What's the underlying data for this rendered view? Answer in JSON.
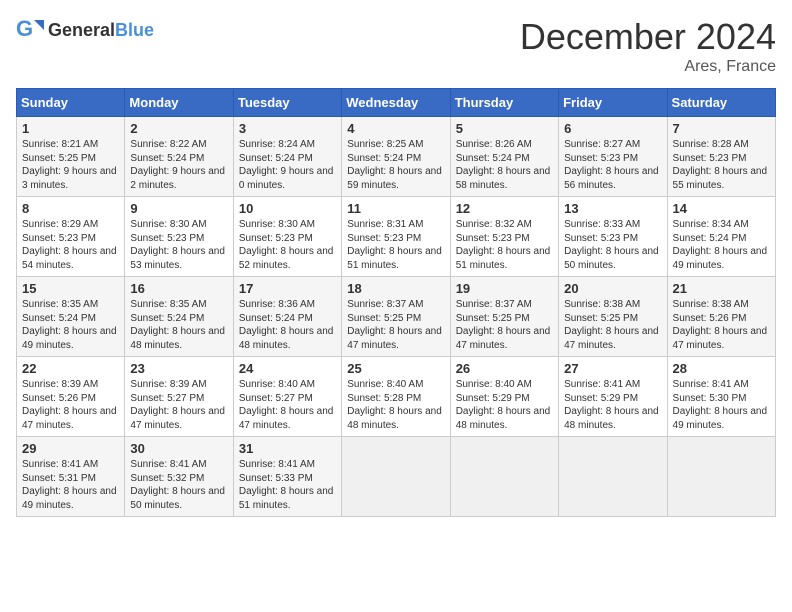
{
  "header": {
    "logo_general": "General",
    "logo_blue": "Blue",
    "title": "December 2024",
    "location": "Ares, France"
  },
  "days_of_week": [
    "Sunday",
    "Monday",
    "Tuesday",
    "Wednesday",
    "Thursday",
    "Friday",
    "Saturday"
  ],
  "weeks": [
    [
      {
        "day": "1",
        "sunrise": "Sunrise: 8:21 AM",
        "sunset": "Sunset: 5:25 PM",
        "daylight": "Daylight: 9 hours and 3 minutes."
      },
      {
        "day": "2",
        "sunrise": "Sunrise: 8:22 AM",
        "sunset": "Sunset: 5:24 PM",
        "daylight": "Daylight: 9 hours and 2 minutes."
      },
      {
        "day": "3",
        "sunrise": "Sunrise: 8:24 AM",
        "sunset": "Sunset: 5:24 PM",
        "daylight": "Daylight: 9 hours and 0 minutes."
      },
      {
        "day": "4",
        "sunrise": "Sunrise: 8:25 AM",
        "sunset": "Sunset: 5:24 PM",
        "daylight": "Daylight: 8 hours and 59 minutes."
      },
      {
        "day": "5",
        "sunrise": "Sunrise: 8:26 AM",
        "sunset": "Sunset: 5:24 PM",
        "daylight": "Daylight: 8 hours and 58 minutes."
      },
      {
        "day": "6",
        "sunrise": "Sunrise: 8:27 AM",
        "sunset": "Sunset: 5:23 PM",
        "daylight": "Daylight: 8 hours and 56 minutes."
      },
      {
        "day": "7",
        "sunrise": "Sunrise: 8:28 AM",
        "sunset": "Sunset: 5:23 PM",
        "daylight": "Daylight: 8 hours and 55 minutes."
      }
    ],
    [
      {
        "day": "8",
        "sunrise": "Sunrise: 8:29 AM",
        "sunset": "Sunset: 5:23 PM",
        "daylight": "Daylight: 8 hours and 54 minutes."
      },
      {
        "day": "9",
        "sunrise": "Sunrise: 8:30 AM",
        "sunset": "Sunset: 5:23 PM",
        "daylight": "Daylight: 8 hours and 53 minutes."
      },
      {
        "day": "10",
        "sunrise": "Sunrise: 8:30 AM",
        "sunset": "Sunset: 5:23 PM",
        "daylight": "Daylight: 8 hours and 52 minutes."
      },
      {
        "day": "11",
        "sunrise": "Sunrise: 8:31 AM",
        "sunset": "Sunset: 5:23 PM",
        "daylight": "Daylight: 8 hours and 51 minutes."
      },
      {
        "day": "12",
        "sunrise": "Sunrise: 8:32 AM",
        "sunset": "Sunset: 5:23 PM",
        "daylight": "Daylight: 8 hours and 51 minutes."
      },
      {
        "day": "13",
        "sunrise": "Sunrise: 8:33 AM",
        "sunset": "Sunset: 5:23 PM",
        "daylight": "Daylight: 8 hours and 50 minutes."
      },
      {
        "day": "14",
        "sunrise": "Sunrise: 8:34 AM",
        "sunset": "Sunset: 5:24 PM",
        "daylight": "Daylight: 8 hours and 49 minutes."
      }
    ],
    [
      {
        "day": "15",
        "sunrise": "Sunrise: 8:35 AM",
        "sunset": "Sunset: 5:24 PM",
        "daylight": "Daylight: 8 hours and 49 minutes."
      },
      {
        "day": "16",
        "sunrise": "Sunrise: 8:35 AM",
        "sunset": "Sunset: 5:24 PM",
        "daylight": "Daylight: 8 hours and 48 minutes."
      },
      {
        "day": "17",
        "sunrise": "Sunrise: 8:36 AM",
        "sunset": "Sunset: 5:24 PM",
        "daylight": "Daylight: 8 hours and 48 minutes."
      },
      {
        "day": "18",
        "sunrise": "Sunrise: 8:37 AM",
        "sunset": "Sunset: 5:25 PM",
        "daylight": "Daylight: 8 hours and 47 minutes."
      },
      {
        "day": "19",
        "sunrise": "Sunrise: 8:37 AM",
        "sunset": "Sunset: 5:25 PM",
        "daylight": "Daylight: 8 hours and 47 minutes."
      },
      {
        "day": "20",
        "sunrise": "Sunrise: 8:38 AM",
        "sunset": "Sunset: 5:25 PM",
        "daylight": "Daylight: 8 hours and 47 minutes."
      },
      {
        "day": "21",
        "sunrise": "Sunrise: 8:38 AM",
        "sunset": "Sunset: 5:26 PM",
        "daylight": "Daylight: 8 hours and 47 minutes."
      }
    ],
    [
      {
        "day": "22",
        "sunrise": "Sunrise: 8:39 AM",
        "sunset": "Sunset: 5:26 PM",
        "daylight": "Daylight: 8 hours and 47 minutes."
      },
      {
        "day": "23",
        "sunrise": "Sunrise: 8:39 AM",
        "sunset": "Sunset: 5:27 PM",
        "daylight": "Daylight: 8 hours and 47 minutes."
      },
      {
        "day": "24",
        "sunrise": "Sunrise: 8:40 AM",
        "sunset": "Sunset: 5:27 PM",
        "daylight": "Daylight: 8 hours and 47 minutes."
      },
      {
        "day": "25",
        "sunrise": "Sunrise: 8:40 AM",
        "sunset": "Sunset: 5:28 PM",
        "daylight": "Daylight: 8 hours and 48 minutes."
      },
      {
        "day": "26",
        "sunrise": "Sunrise: 8:40 AM",
        "sunset": "Sunset: 5:29 PM",
        "daylight": "Daylight: 8 hours and 48 minutes."
      },
      {
        "day": "27",
        "sunrise": "Sunrise: 8:41 AM",
        "sunset": "Sunset: 5:29 PM",
        "daylight": "Daylight: 8 hours and 48 minutes."
      },
      {
        "day": "28",
        "sunrise": "Sunrise: 8:41 AM",
        "sunset": "Sunset: 5:30 PM",
        "daylight": "Daylight: 8 hours and 49 minutes."
      }
    ],
    [
      {
        "day": "29",
        "sunrise": "Sunrise: 8:41 AM",
        "sunset": "Sunset: 5:31 PM",
        "daylight": "Daylight: 8 hours and 49 minutes."
      },
      {
        "day": "30",
        "sunrise": "Sunrise: 8:41 AM",
        "sunset": "Sunset: 5:32 PM",
        "daylight": "Daylight: 8 hours and 50 minutes."
      },
      {
        "day": "31",
        "sunrise": "Sunrise: 8:41 AM",
        "sunset": "Sunset: 5:33 PM",
        "daylight": "Daylight: 8 hours and 51 minutes."
      },
      null,
      null,
      null,
      null
    ]
  ]
}
